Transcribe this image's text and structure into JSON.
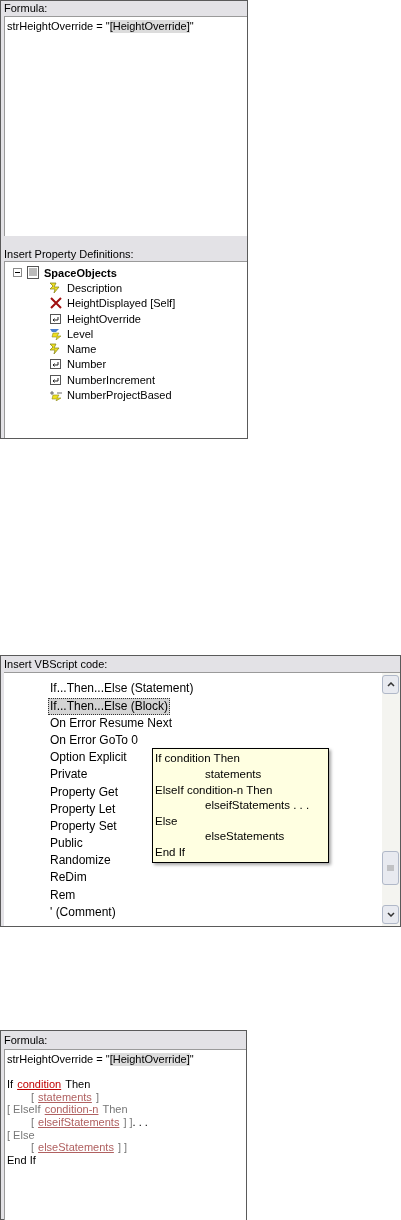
{
  "property_panel": {
    "formula": {
      "label": "Formula:",
      "lines": [
        {
          "indented": false,
          "tokens": [
            {
              "kind": "code",
              "text": "strHeightOverride = \""
            },
            {
              "kind": "highlight",
              "text": "[HeightOverride]"
            },
            {
              "kind": "code",
              "text": "\""
            }
          ]
        }
      ]
    },
    "definitions": {
      "label": "Insert Property Definitions:",
      "tree": [
        {
          "label": "SpaceObjects",
          "expanded": true,
          "children": [
            {
              "label": "Description",
              "kind": "text"
            },
            {
              "label": "HeightDisplayed [Self]",
              "kind": "invalid"
            },
            {
              "label": "HeightOverride",
              "kind": "manual"
            },
            {
              "label": "Level",
              "kind": "list"
            },
            {
              "label": "Name",
              "kind": "text"
            },
            {
              "label": "Number",
              "kind": "manual"
            },
            {
              "label": "NumberIncrement",
              "kind": "manual"
            },
            {
              "label": "NumberProjectBased",
              "kind": "formula"
            }
          ]
        }
      ]
    }
  },
  "vbscript_panel": {
    "label": "Insert VBScript code:",
    "items": [
      {
        "label": "If...Then...Else (Statement)",
        "selected": false
      },
      {
        "label": "If...Then...Else (Block)",
        "selected": true
      },
      {
        "label": "On Error Resume Next",
        "selected": false
      },
      {
        "label": "On Error GoTo 0",
        "selected": false
      },
      {
        "label": "Option Explicit",
        "selected": false
      },
      {
        "label": "Private",
        "selected": false
      },
      {
        "label": "Property Get",
        "selected": false
      },
      {
        "label": "Property Let",
        "selected": false
      },
      {
        "label": "Property Set",
        "selected": false
      },
      {
        "label": "Public",
        "selected": false
      },
      {
        "label": "Randomize",
        "selected": false
      },
      {
        "label": "ReDim",
        "selected": false
      },
      {
        "label": "Rem",
        "selected": false
      },
      {
        "label": "' (Comment)",
        "selected": false
      }
    ],
    "tooltip": {
      "lines": [
        {
          "text": "If condition Then",
          "indented": false
        },
        {
          "text": "statements",
          "indented": true
        },
        {
          "text": "ElseIf condition-n Then",
          "indented": false
        },
        {
          "text": "elseifStatements . . .",
          "indented": true
        },
        {
          "text": "Else",
          "indented": false
        },
        {
          "text": "elseStatements",
          "indented": true
        },
        {
          "text": "End If",
          "indented": false
        }
      ]
    }
  },
  "formula_panel": {
    "label": "Formula:",
    "lines": [
      {
        "indented": false,
        "blank_after": true,
        "tokens": [
          {
            "kind": "code",
            "text": "strHeightOverride = \""
          },
          {
            "kind": "highlight",
            "text": "[HeightOverride]"
          },
          {
            "kind": "code",
            "text": "\""
          }
        ]
      },
      {
        "indented": false,
        "tokens": [
          {
            "kind": "code",
            "text": "If"
          },
          {
            "kind": "required",
            "text": "condition"
          },
          {
            "kind": "code",
            "text": "Then"
          }
        ]
      },
      {
        "indented": true,
        "tokens": [
          {
            "kind": "optional",
            "text": "["
          },
          {
            "kind": "placeholder",
            "text": "statements"
          },
          {
            "kind": "optional",
            "text": "]"
          }
        ]
      },
      {
        "indented": false,
        "tokens": [
          {
            "kind": "optional",
            "text": "[ ElseIf"
          },
          {
            "kind": "placeholder",
            "text": "condition-n"
          },
          {
            "kind": "optional",
            "text": "Then"
          }
        ]
      },
      {
        "indented": true,
        "tokens": [
          {
            "kind": "optional",
            "text": "["
          },
          {
            "kind": "placeholder",
            "text": "elseifStatements"
          },
          {
            "kind": "optional",
            "text": "] ]"
          },
          {
            "kind": "code",
            "text": ". . ."
          }
        ]
      },
      {
        "indented": false,
        "tokens": [
          {
            "kind": "optional",
            "text": "[ Else"
          }
        ]
      },
      {
        "indented": true,
        "tokens": [
          {
            "kind": "optional",
            "text": "["
          },
          {
            "kind": "placeholder",
            "text": "elseStatements"
          },
          {
            "kind": "optional",
            "text": "] ]"
          }
        ]
      },
      {
        "indented": false,
        "tokens": [
          {
            "kind": "code",
            "text": "End If"
          }
        ]
      }
    ]
  }
}
